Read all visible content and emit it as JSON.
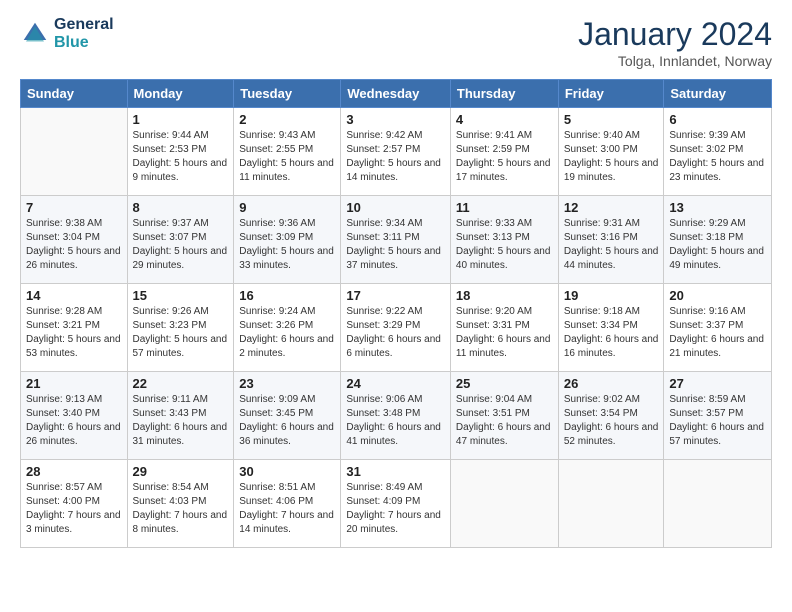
{
  "header": {
    "logo_line1": "General",
    "logo_line2": "Blue",
    "month_title": "January 2024",
    "location": "Tolga, Innlandet, Norway"
  },
  "days_of_week": [
    "Sunday",
    "Monday",
    "Tuesday",
    "Wednesday",
    "Thursday",
    "Friday",
    "Saturday"
  ],
  "weeks": [
    [
      {
        "day": "",
        "sunrise": "",
        "sunset": "",
        "daylight": ""
      },
      {
        "day": "1",
        "sunrise": "Sunrise: 9:44 AM",
        "sunset": "Sunset: 2:53 PM",
        "daylight": "Daylight: 5 hours and 9 minutes."
      },
      {
        "day": "2",
        "sunrise": "Sunrise: 9:43 AM",
        "sunset": "Sunset: 2:55 PM",
        "daylight": "Daylight: 5 hours and 11 minutes."
      },
      {
        "day": "3",
        "sunrise": "Sunrise: 9:42 AM",
        "sunset": "Sunset: 2:57 PM",
        "daylight": "Daylight: 5 hours and 14 minutes."
      },
      {
        "day": "4",
        "sunrise": "Sunrise: 9:41 AM",
        "sunset": "Sunset: 2:59 PM",
        "daylight": "Daylight: 5 hours and 17 minutes."
      },
      {
        "day": "5",
        "sunrise": "Sunrise: 9:40 AM",
        "sunset": "Sunset: 3:00 PM",
        "daylight": "Daylight: 5 hours and 19 minutes."
      },
      {
        "day": "6",
        "sunrise": "Sunrise: 9:39 AM",
        "sunset": "Sunset: 3:02 PM",
        "daylight": "Daylight: 5 hours and 23 minutes."
      }
    ],
    [
      {
        "day": "7",
        "sunrise": "Sunrise: 9:38 AM",
        "sunset": "Sunset: 3:04 PM",
        "daylight": "Daylight: 5 hours and 26 minutes."
      },
      {
        "day": "8",
        "sunrise": "Sunrise: 9:37 AM",
        "sunset": "Sunset: 3:07 PM",
        "daylight": "Daylight: 5 hours and 29 minutes."
      },
      {
        "day": "9",
        "sunrise": "Sunrise: 9:36 AM",
        "sunset": "Sunset: 3:09 PM",
        "daylight": "Daylight: 5 hours and 33 minutes."
      },
      {
        "day": "10",
        "sunrise": "Sunrise: 9:34 AM",
        "sunset": "Sunset: 3:11 PM",
        "daylight": "Daylight: 5 hours and 37 minutes."
      },
      {
        "day": "11",
        "sunrise": "Sunrise: 9:33 AM",
        "sunset": "Sunset: 3:13 PM",
        "daylight": "Daylight: 5 hours and 40 minutes."
      },
      {
        "day": "12",
        "sunrise": "Sunrise: 9:31 AM",
        "sunset": "Sunset: 3:16 PM",
        "daylight": "Daylight: 5 hours and 44 minutes."
      },
      {
        "day": "13",
        "sunrise": "Sunrise: 9:29 AM",
        "sunset": "Sunset: 3:18 PM",
        "daylight": "Daylight: 5 hours and 49 minutes."
      }
    ],
    [
      {
        "day": "14",
        "sunrise": "Sunrise: 9:28 AM",
        "sunset": "Sunset: 3:21 PM",
        "daylight": "Daylight: 5 hours and 53 minutes."
      },
      {
        "day": "15",
        "sunrise": "Sunrise: 9:26 AM",
        "sunset": "Sunset: 3:23 PM",
        "daylight": "Daylight: 5 hours and 57 minutes."
      },
      {
        "day": "16",
        "sunrise": "Sunrise: 9:24 AM",
        "sunset": "Sunset: 3:26 PM",
        "daylight": "Daylight: 6 hours and 2 minutes."
      },
      {
        "day": "17",
        "sunrise": "Sunrise: 9:22 AM",
        "sunset": "Sunset: 3:29 PM",
        "daylight": "Daylight: 6 hours and 6 minutes."
      },
      {
        "day": "18",
        "sunrise": "Sunrise: 9:20 AM",
        "sunset": "Sunset: 3:31 PM",
        "daylight": "Daylight: 6 hours and 11 minutes."
      },
      {
        "day": "19",
        "sunrise": "Sunrise: 9:18 AM",
        "sunset": "Sunset: 3:34 PM",
        "daylight": "Daylight: 6 hours and 16 minutes."
      },
      {
        "day": "20",
        "sunrise": "Sunrise: 9:16 AM",
        "sunset": "Sunset: 3:37 PM",
        "daylight": "Daylight: 6 hours and 21 minutes."
      }
    ],
    [
      {
        "day": "21",
        "sunrise": "Sunrise: 9:13 AM",
        "sunset": "Sunset: 3:40 PM",
        "daylight": "Daylight: 6 hours and 26 minutes."
      },
      {
        "day": "22",
        "sunrise": "Sunrise: 9:11 AM",
        "sunset": "Sunset: 3:43 PM",
        "daylight": "Daylight: 6 hours and 31 minutes."
      },
      {
        "day": "23",
        "sunrise": "Sunrise: 9:09 AM",
        "sunset": "Sunset: 3:45 PM",
        "daylight": "Daylight: 6 hours and 36 minutes."
      },
      {
        "day": "24",
        "sunrise": "Sunrise: 9:06 AM",
        "sunset": "Sunset: 3:48 PM",
        "daylight": "Daylight: 6 hours and 41 minutes."
      },
      {
        "day": "25",
        "sunrise": "Sunrise: 9:04 AM",
        "sunset": "Sunset: 3:51 PM",
        "daylight": "Daylight: 6 hours and 47 minutes."
      },
      {
        "day": "26",
        "sunrise": "Sunrise: 9:02 AM",
        "sunset": "Sunset: 3:54 PM",
        "daylight": "Daylight: 6 hours and 52 minutes."
      },
      {
        "day": "27",
        "sunrise": "Sunrise: 8:59 AM",
        "sunset": "Sunset: 3:57 PM",
        "daylight": "Daylight: 6 hours and 57 minutes."
      }
    ],
    [
      {
        "day": "28",
        "sunrise": "Sunrise: 8:57 AM",
        "sunset": "Sunset: 4:00 PM",
        "daylight": "Daylight: 7 hours and 3 minutes."
      },
      {
        "day": "29",
        "sunrise": "Sunrise: 8:54 AM",
        "sunset": "Sunset: 4:03 PM",
        "daylight": "Daylight: 7 hours and 8 minutes."
      },
      {
        "day": "30",
        "sunrise": "Sunrise: 8:51 AM",
        "sunset": "Sunset: 4:06 PM",
        "daylight": "Daylight: 7 hours and 14 minutes."
      },
      {
        "day": "31",
        "sunrise": "Sunrise: 8:49 AM",
        "sunset": "Sunset: 4:09 PM",
        "daylight": "Daylight: 7 hours and 20 minutes."
      },
      {
        "day": "",
        "sunrise": "",
        "sunset": "",
        "daylight": ""
      },
      {
        "day": "",
        "sunrise": "",
        "sunset": "",
        "daylight": ""
      },
      {
        "day": "",
        "sunrise": "",
        "sunset": "",
        "daylight": ""
      }
    ]
  ]
}
